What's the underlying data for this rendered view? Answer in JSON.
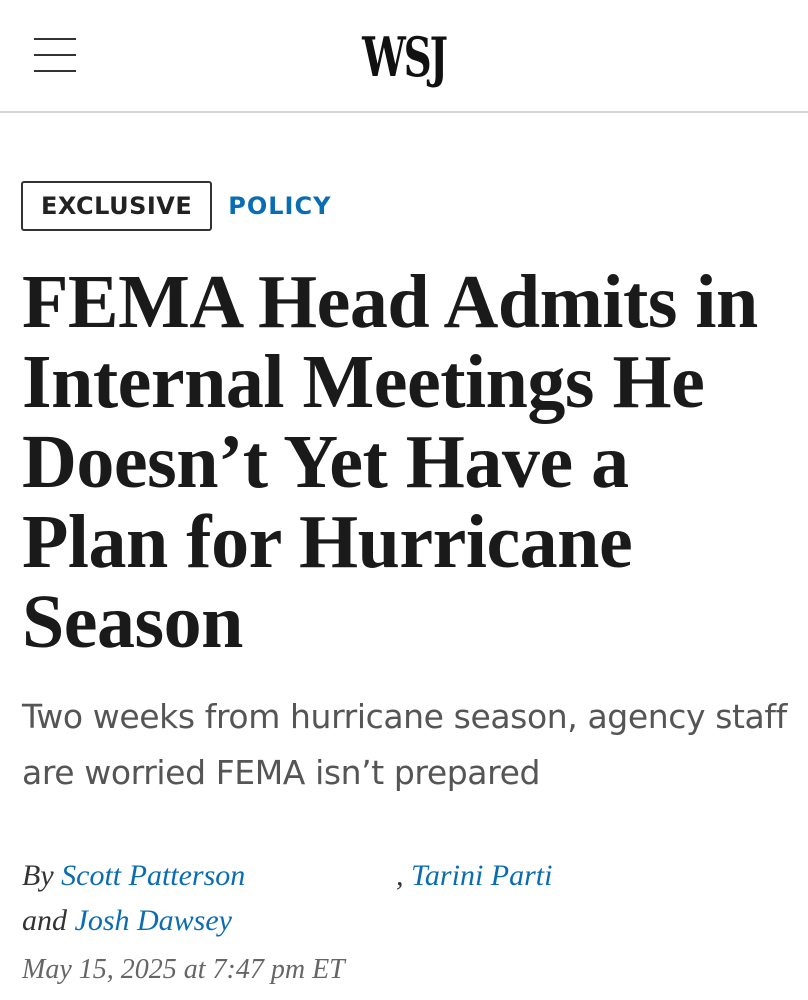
{
  "header": {
    "logo": "WSJ",
    "menu_icon": "hamburger-menu-icon"
  },
  "tags": {
    "exclusive": "EXCLUSIVE",
    "section": "POLICY"
  },
  "article": {
    "headline": "FEMA Head Admits in Internal Meetings He Doesn’t Yet Have a Plan for Hurricane Season",
    "dek": "Two weeks from hurricane season, agency staff are worried FEMA isn’t prepared",
    "byline": {
      "by_prefix": "By",
      "authors": [
        "Scott Patterson",
        "Tarini Parti",
        "Josh Dawsey"
      ],
      "separator": ",",
      "and_prefix": "and"
    },
    "timestamp": "May 15, 2025 at 7:47 pm ET"
  },
  "colors": {
    "link_blue": "#0a6db4",
    "headline_text": "#1a1a1a",
    "dek_text": "#555555"
  }
}
